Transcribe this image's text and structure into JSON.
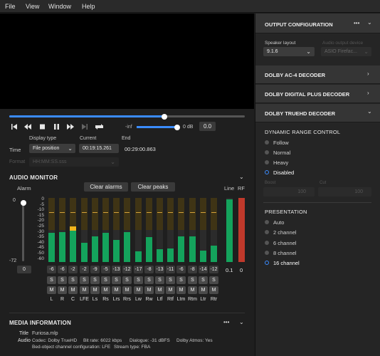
{
  "menu": [
    "File",
    "View",
    "Window",
    "Help"
  ],
  "transport": {
    "volume_label": "-inf",
    "db_label": "0 dB",
    "db_value": "0.0",
    "progress_fraction": 0.66,
    "volume_fraction": 1.0
  },
  "time": {
    "time_label": "Time",
    "display_type_label": "Display type",
    "display_type_value": "File position",
    "current_label": "Current",
    "current_value": "00:19:15.261",
    "end_label": "End",
    "end_value": "00:29:00.863",
    "format_label": "Format",
    "format_value": "HH:MM:SS.sss"
  },
  "audio_monitor": {
    "title": "AUDIO MONITOR",
    "alarm_label": "Alarm",
    "clear_alarms": "Clear alarms",
    "clear_peaks": "Clear peaks",
    "line_label": "Line",
    "rf_label": "RF",
    "alarm_top": "0",
    "alarm_bottom": "-72",
    "alarm_value": "0",
    "scale": [
      "0",
      "-5",
      "-10",
      "-15",
      "-20",
      "-25",
      "-30",
      "-35",
      "-40",
      "-45",
      "-50",
      "-60"
    ],
    "channels": [
      {
        "name": "L",
        "peak": "-6",
        "level": 0.45
      },
      {
        "name": "R",
        "peak": "-6",
        "level": 0.47
      },
      {
        "name": "C",
        "peak": "-2",
        "level": 0.53
      },
      {
        "name": "LFE",
        "peak": "-2",
        "level": 0.3
      },
      {
        "name": "Ls",
        "peak": "-9",
        "level": 0.4
      },
      {
        "name": "Rs",
        "peak": "-5",
        "level": 0.46
      },
      {
        "name": "Lrs",
        "peak": "-13",
        "level": 0.34
      },
      {
        "name": "Rrs",
        "peak": "-12",
        "level": 0.47
      },
      {
        "name": "Lw",
        "peak": "-17",
        "level": 0.17
      },
      {
        "name": "Rw",
        "peak": "-8",
        "level": 0.39
      },
      {
        "name": "Ltf",
        "peak": "-13",
        "level": 0.2
      },
      {
        "name": "Rtf",
        "peak": "-11",
        "level": 0.21
      },
      {
        "name": "Ltm",
        "peak": "-6",
        "level": 0.4
      },
      {
        "name": "Rtm",
        "peak": "-8",
        "level": 0.4
      },
      {
        "name": "Ltr",
        "peak": "-14",
        "level": 0.18
      },
      {
        "name": "Rtr",
        "peak": "-12",
        "level": 0.25
      }
    ],
    "line_value": "0.1",
    "rf_value": "0",
    "s_label": "S",
    "m_label": "M"
  },
  "media_info": {
    "title": "MEDIA INFORMATION",
    "title_label": "Title",
    "title_value": "Furiosa.mlp",
    "audio_label": "Audio",
    "codec": "Codec: Dolby TrueHD",
    "bitrate": "Bit rate: 6022 kbps",
    "dialogue": "Dialogue: -31 dBFS",
    "atmos": "Dolby Atmos: Yes",
    "bed": "Bed-object channel configuration: LFE",
    "stream": "Stream type: FBA"
  },
  "right": {
    "output_config": "OUTPUT CONFIGURATION",
    "speaker_layout_label": "Speaker layout",
    "speaker_layout_value": "9.1.6",
    "audio_output_label": "Audio output device",
    "audio_output_value": "ASIO Firefac...",
    "ac4": "DOLBY AC-4 DECODER",
    "ddp": "DOLBY DIGITAL PLUS DECODER",
    "truehd": "DOLBY TRUEHD DECODER",
    "drc_title": "DYNAMIC RANGE CONTROL",
    "drc_options": [
      "Follow",
      "Normal",
      "Heavy",
      "Disabled"
    ],
    "drc_selected": 3,
    "boost_label": "Boost",
    "boost_value": "100",
    "cut_label": "Cut",
    "cut_value": "100",
    "presentation_title": "PRESENTATION",
    "presentation_options": [
      "Auto",
      "2 channel",
      "6 channel",
      "8 channel",
      "16 channel"
    ],
    "presentation_selected": 4,
    "more": "•••"
  },
  "colors": {
    "accent": "#3a8cff",
    "meter_green": "#14a35c",
    "meter_yellow": "#f1b51c"
  }
}
